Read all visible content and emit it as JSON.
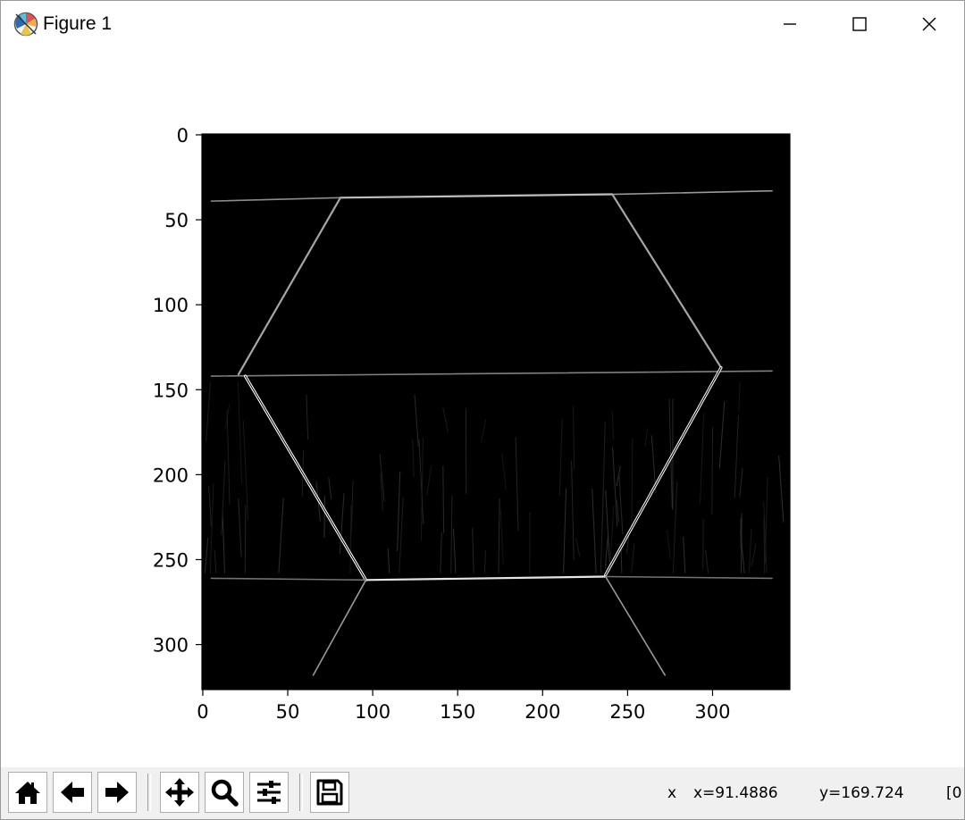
{
  "window": {
    "title": "Figure 1",
    "icon": "matplotlib-logo-icon",
    "controls": [
      "minimize-icon",
      "maximize-icon",
      "close-icon"
    ]
  },
  "toolbar": {
    "buttons": [
      {
        "name": "home-button",
        "icon": "home-icon"
      },
      {
        "name": "back-button",
        "icon": "arrow-left-icon"
      },
      {
        "name": "forward-button",
        "icon": "arrow-right-icon"
      },
      {
        "name": "pan-button",
        "icon": "move-arrows-icon"
      },
      {
        "name": "zoom-button",
        "icon": "magnifier-icon"
      },
      {
        "name": "configure-subplots-button",
        "icon": "sliders-icon"
      },
      {
        "name": "save-button",
        "icon": "floppy-disk-icon"
      }
    ],
    "status": {
      "x_label": "x",
      "x_value": "x=91.4886",
      "y_value": "y=169.724",
      "extra": "[0"
    }
  },
  "chart_data": {
    "type": "image",
    "description_kind": "grayscale edge-detection image",
    "colormap": "gray",
    "image_width": 346,
    "image_height": 327,
    "xlim": [
      -0.5,
      345.5
    ],
    "ylim": [
      326.5,
      -0.5
    ],
    "x_ticks": [
      0,
      50,
      100,
      150,
      200,
      250,
      300
    ],
    "y_ticks": [
      0,
      50,
      100,
      150,
      200,
      250,
      300
    ],
    "edge_segments": [
      {
        "x": [
          5,
          81
        ],
        "y": [
          39,
          37
        ],
        "intensity": 0.55
      },
      {
        "x": [
          81,
          241
        ],
        "y": [
          37,
          35
        ],
        "intensity": 0.75
      },
      {
        "x": [
          241,
          335
        ],
        "y": [
          35,
          33
        ],
        "intensity": 0.6
      },
      {
        "x": [
          81,
          21
        ],
        "y": [
          37,
          141
        ],
        "intensity": 0.65
      },
      {
        "x": [
          241,
          305
        ],
        "y": [
          35,
          137
        ],
        "intensity": 0.65
      },
      {
        "x": [
          5,
          335
        ],
        "y": [
          142,
          139
        ],
        "intensity": 0.5
      },
      {
        "x": [
          25,
          96
        ],
        "y": [
          142,
          262
        ],
        "intensity": 1.0
      },
      {
        "x": [
          305,
          237
        ],
        "y": [
          137,
          259
        ],
        "intensity": 0.95
      },
      {
        "x": [
          96,
          237
        ],
        "y": [
          262,
          260
        ],
        "intensity": 0.9
      },
      {
        "x": [
          5,
          96
        ],
        "y": [
          261,
          262
        ],
        "intensity": 0.45
      },
      {
        "x": [
          237,
          335
        ],
        "y": [
          260,
          261
        ],
        "intensity": 0.45
      },
      {
        "x": [
          96,
          65
        ],
        "y": [
          262,
          318
        ],
        "intensity": 0.6
      },
      {
        "x": [
          237,
          272
        ],
        "y": [
          260,
          318
        ],
        "intensity": 0.6
      }
    ]
  }
}
